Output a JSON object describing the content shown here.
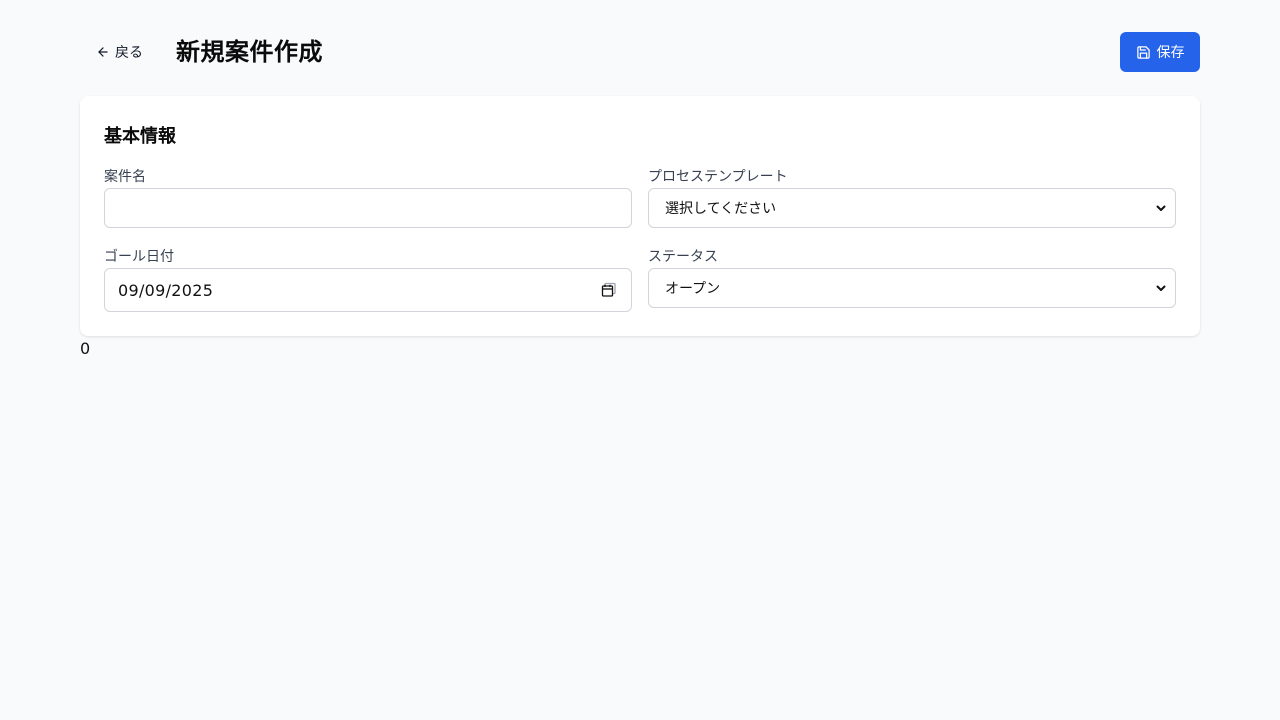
{
  "header": {
    "back_label": "戻る",
    "title": "新規案件作成",
    "save_label": "保存",
    "accent_color": "#2563eb"
  },
  "card": {
    "title": "基本情報",
    "fields": {
      "case_name": {
        "label": "案件名",
        "value": "",
        "placeholder": ""
      },
      "process_template": {
        "label": "プロセステンプレート",
        "selected": "選択してください"
      },
      "goal_date": {
        "label": "ゴール日付",
        "value": "09/09/2025"
      },
      "status": {
        "label": "ステータス",
        "selected": "オープン"
      }
    }
  },
  "footer_text": "0",
  "icons": {
    "back": "arrow-left-icon",
    "save": "save-icon",
    "calendar": "calendar-icon",
    "select": "chevron-down-icon"
  }
}
